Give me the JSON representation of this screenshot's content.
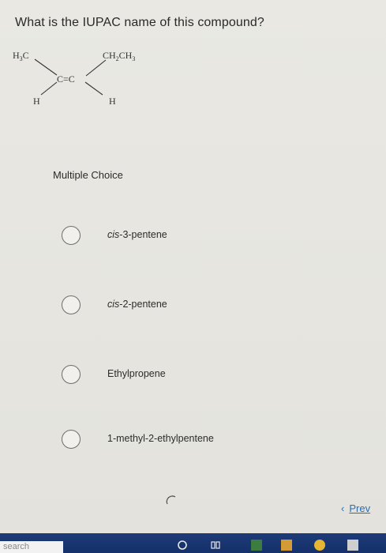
{
  "question": "What is the IUPAC name of this compound?",
  "molecule": {
    "top_left": "H3C",
    "top_right": "CH2CH3",
    "center": "C=C",
    "bottom_left": "H",
    "bottom_right": "H"
  },
  "multiple_choice_label": "Multiple Choice",
  "options": [
    {
      "prefix": "cis",
      "rest": "-3-pentene"
    },
    {
      "prefix": "cis",
      "rest": "-2-pentene"
    },
    {
      "prefix": "",
      "rest": "Ethylpropene"
    },
    {
      "prefix": "",
      "rest": "1-methyl-2-ethylpentene"
    }
  ],
  "nav": {
    "prev_label": "Prev",
    "prev_icon": "chevron-left-icon"
  },
  "taskbar": {
    "search_placeholder": "search",
    "accent": "#1d3b78"
  },
  "colors": {
    "link": "#2a6fb6",
    "background": "#e8e7e2"
  }
}
